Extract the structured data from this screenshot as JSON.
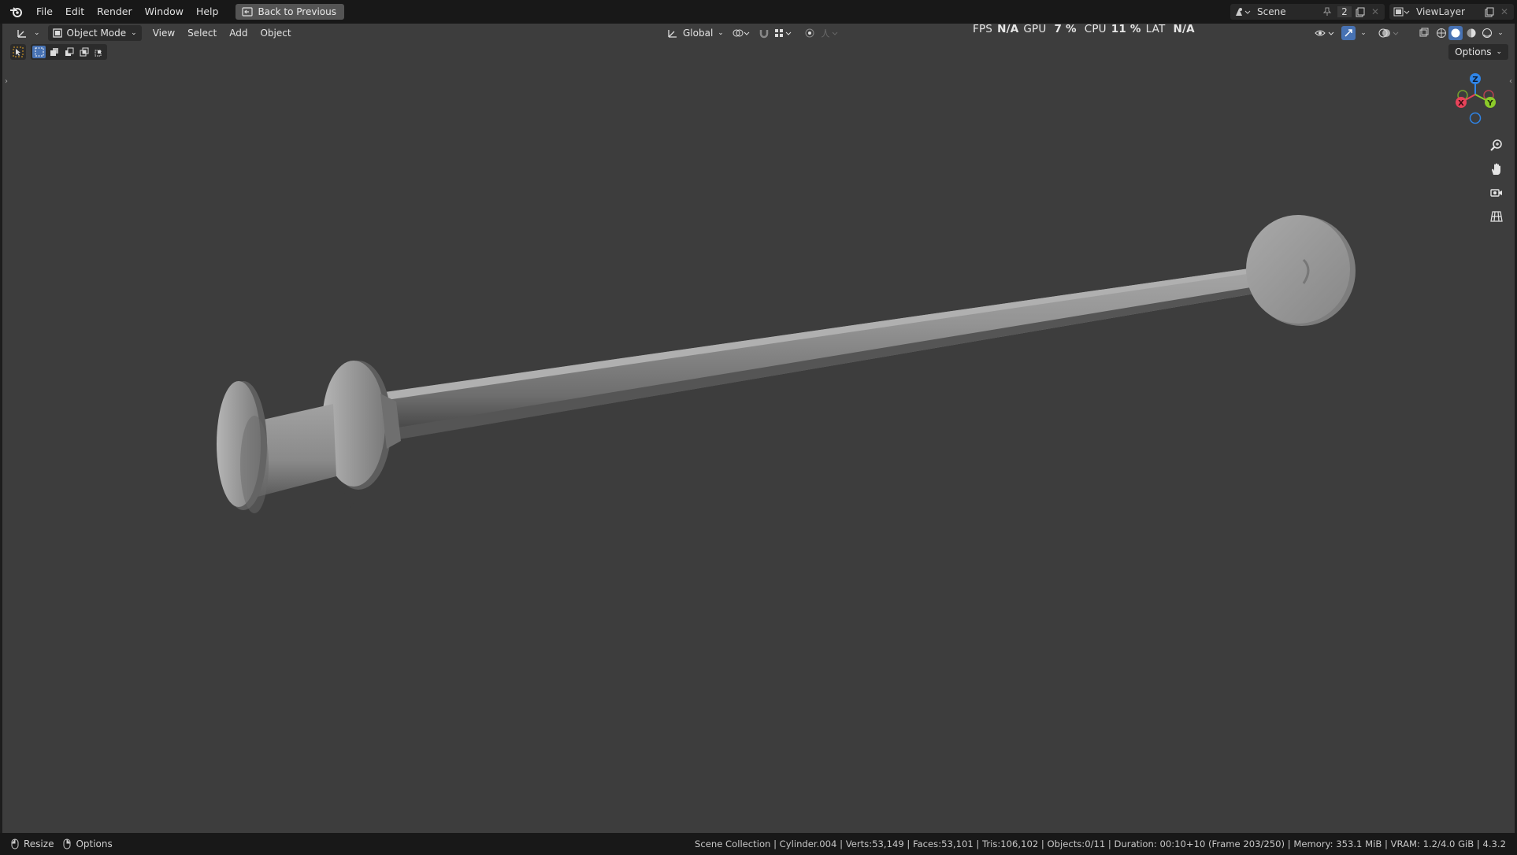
{
  "menu": {
    "file": "File",
    "edit": "Edit",
    "render": "Render",
    "window": "Window",
    "help": "Help"
  },
  "back_button": "Back to Previous",
  "scene": {
    "name": "Scene",
    "count": "2"
  },
  "view_layer": "ViewLayer",
  "viewport_header": {
    "mode": "Object Mode",
    "view": "View",
    "select": "Select",
    "add": "Add",
    "object": "Object",
    "orientation": "Global"
  },
  "stats": {
    "fps_label": "FPS",
    "fps_value": "N/A",
    "gpu_label": "GPU",
    "gpu_value": "7 %",
    "cpu_label": "CPU",
    "cpu_value": "11 %",
    "lat_label": "LAT",
    "lat_value": "N/A"
  },
  "options_label": "Options",
  "gizmo": {
    "x": "X",
    "y": "Y",
    "z": "Z"
  },
  "statusbar": {
    "resize": "Resize",
    "options": "Options",
    "info": "Scene Collection | Cylinder.004 | Verts:53,149 | Faces:53,101 | Tris:106,102 | Objects:0/11 | Duration: 00:10+10 (Frame 203/250) | Memory: 353.1 MiB | VRAM: 1.2/4.0 GiB | 4.3.2"
  },
  "colors": {
    "viewport_bg": "#3d3d3d",
    "accent": "#4772b3",
    "axis_x": "#e8435a",
    "axis_y": "#8ccb2a",
    "axis_z": "#2f85e8"
  }
}
